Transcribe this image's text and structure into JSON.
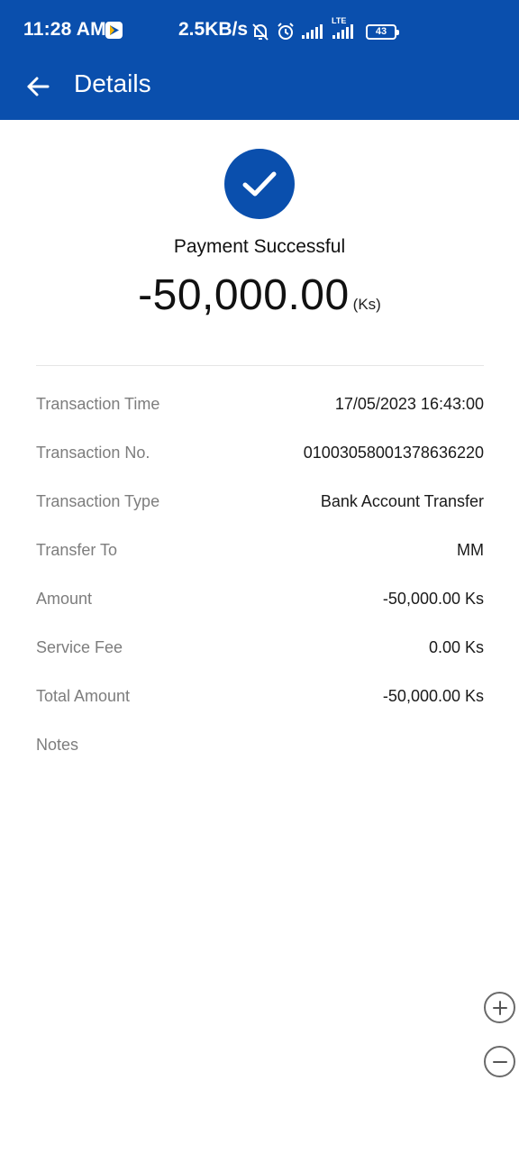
{
  "status_bar": {
    "time": "11:28 AM",
    "network_speed": "2.5KB/s",
    "battery": "43",
    "lte_label": "LTE",
    "icons": [
      "play-store-icon",
      "mute-bell-icon",
      "alarm-icon",
      "signal-icon",
      "signal-lte-icon",
      "battery-icon"
    ]
  },
  "header": {
    "title": "Details",
    "back_icon": "arrow-left-icon"
  },
  "summary": {
    "status_icon": "check-icon",
    "status_text": "Payment Successful",
    "amount": "-50,000.00",
    "unit": "(Ks)"
  },
  "details": [
    {
      "label": "Transaction Time",
      "value": "17/05/2023 16:43:00"
    },
    {
      "label": "Transaction No.",
      "value": "01003058001378636220"
    },
    {
      "label": "Transaction Type",
      "value": "Bank Account Transfer"
    },
    {
      "label": "Transfer To",
      "value": "MM"
    },
    {
      "label": "Amount",
      "value": "-50,000.00 Ks"
    },
    {
      "label": "Service Fee",
      "value": "0.00 Ks"
    },
    {
      "label": "Total Amount",
      "value": "-50,000.00 Ks"
    },
    {
      "label": "Notes",
      "value": ""
    }
  ],
  "zoom": {
    "in_icon": "zoom-in-icon",
    "out_icon": "zoom-out-icon"
  },
  "colors": {
    "brand": "#0a4fad",
    "label_gray": "#7d7d7d"
  }
}
